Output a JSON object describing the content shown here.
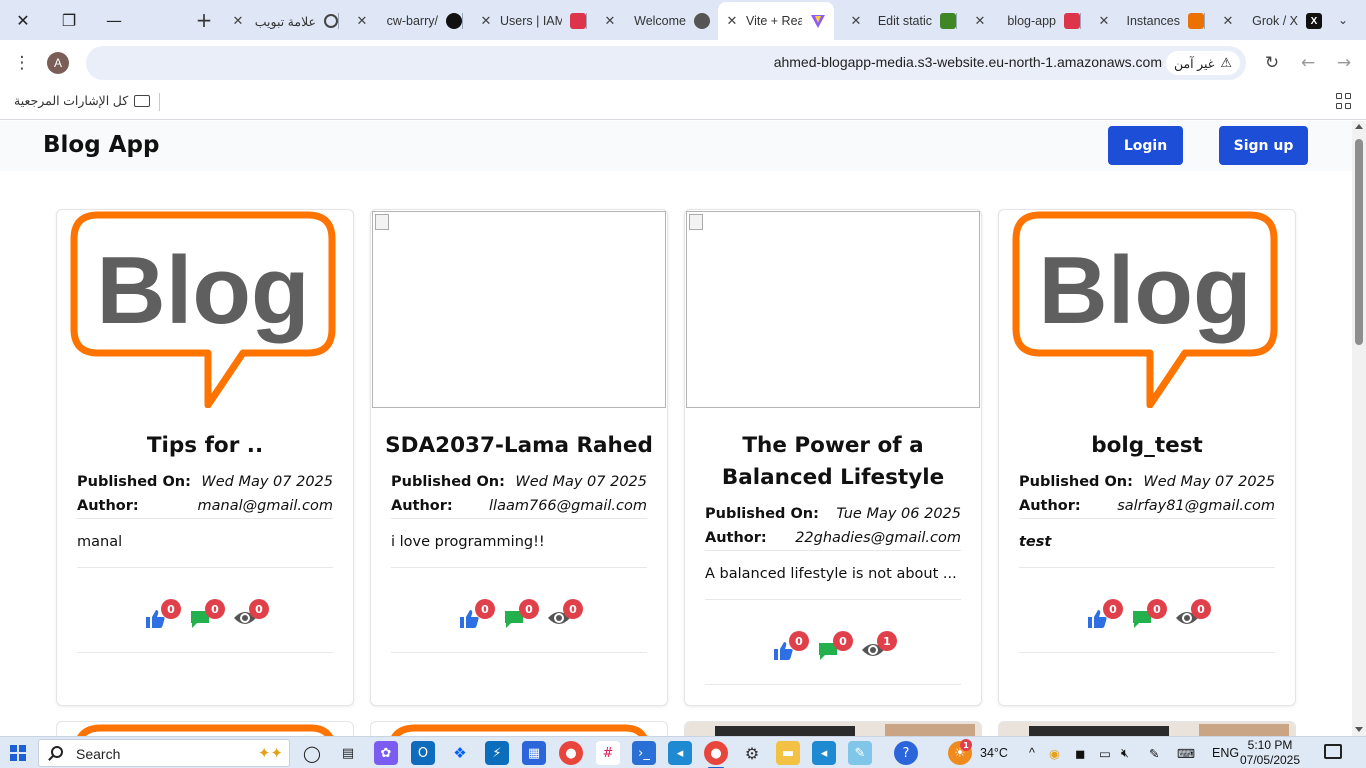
{
  "browser": {
    "window_close": "✕",
    "window_restore": "❐",
    "window_minimize": "—",
    "new_tab": "+",
    "tab_search": "⌄",
    "tabs": [
      {
        "title": "علامة تبويب",
        "favicon": "chrome-icon",
        "color": "#ffffff"
      },
      {
        "title": "cw-barry/",
        "favicon": "github-icon",
        "color": "#111111"
      },
      {
        "title": "Users | IAM",
        "favicon": "aws-iam-icon",
        "color": "#dd344c"
      },
      {
        "title": "Welcome",
        "favicon": "globe-icon",
        "color": "#555555"
      },
      {
        "title": "Vite + React",
        "favicon": "vite-icon",
        "color": "#8b5cf6",
        "active": true
      },
      {
        "title": "Edit static",
        "favicon": "aws-s3-icon",
        "color": "#3f8624"
      },
      {
        "title": "blog-app",
        "favicon": "aws-icon",
        "color": "#dd344c"
      },
      {
        "title": "Instances",
        "favicon": "aws-ec2-icon",
        "color": "#ed7100"
      },
      {
        "title": "Grok / X",
        "favicon": "x-icon",
        "color": "#111111"
      }
    ],
    "url": "ahmed-blogapp-media.s3-website.eu-north-1.amazonaws.com",
    "security_label": "غير آمن",
    "profile_initial": "A",
    "bookmarks_all": "كل الإشارات المرجعية"
  },
  "app": {
    "brand": "Blog App",
    "login_label": "Login",
    "signup_label": "Sign up"
  },
  "posts": [
    {
      "title": "Tips for ..",
      "published_label": "Published On:",
      "published": "Wed May 07 2025",
      "author_label": "Author:",
      "author": "manal@gmail.com",
      "excerpt": "manal",
      "image": "blog-logo",
      "likes": "0",
      "comments": "0",
      "views": "0"
    },
    {
      "title": "SDA2037-Lama Rahed",
      "published_label": "Published On:",
      "published": "Wed May 07 2025",
      "author_label": "Author:",
      "author": "llaam766@gmail.com",
      "excerpt": "i love programming!!",
      "image": "broken",
      "likes": "0",
      "comments": "0",
      "views": "0"
    },
    {
      "title_line1": "The Power of a",
      "title_line2": "Balanced Lifestyle",
      "published_label": "Published On:",
      "published": "Tue May 06 2025",
      "author_label": "Author:",
      "author": "22ghadies@gmail.com",
      "excerpt": "A balanced lifestyle is not about ...",
      "image": "broken",
      "likes": "0",
      "comments": "0",
      "views": "1"
    },
    {
      "title": "bolg_test",
      "published_label": "Published On:",
      "published": "Wed May 07 2025",
      "author_label": "Author:",
      "author": "salrfay81@gmail.com",
      "excerpt": "test",
      "image": "blog-logo",
      "likes": "0",
      "comments": "0",
      "views": "0"
    }
  ],
  "colors": {
    "primary_button": "#1d4ed8",
    "badge": "#e0404a",
    "like_icon": "#2f6fe4",
    "comment_icon": "#22b14c",
    "view_icon": "#555555",
    "logo_orange": "#ff7300",
    "logo_gray": "#5f5f5f"
  },
  "logo_text": "Blog",
  "taskbar": {
    "search_label": "Search",
    "weather": "34°C",
    "language": "ENG",
    "time": "5:10 PM",
    "date": "07/05/2025",
    "weather_alert": "1"
  }
}
